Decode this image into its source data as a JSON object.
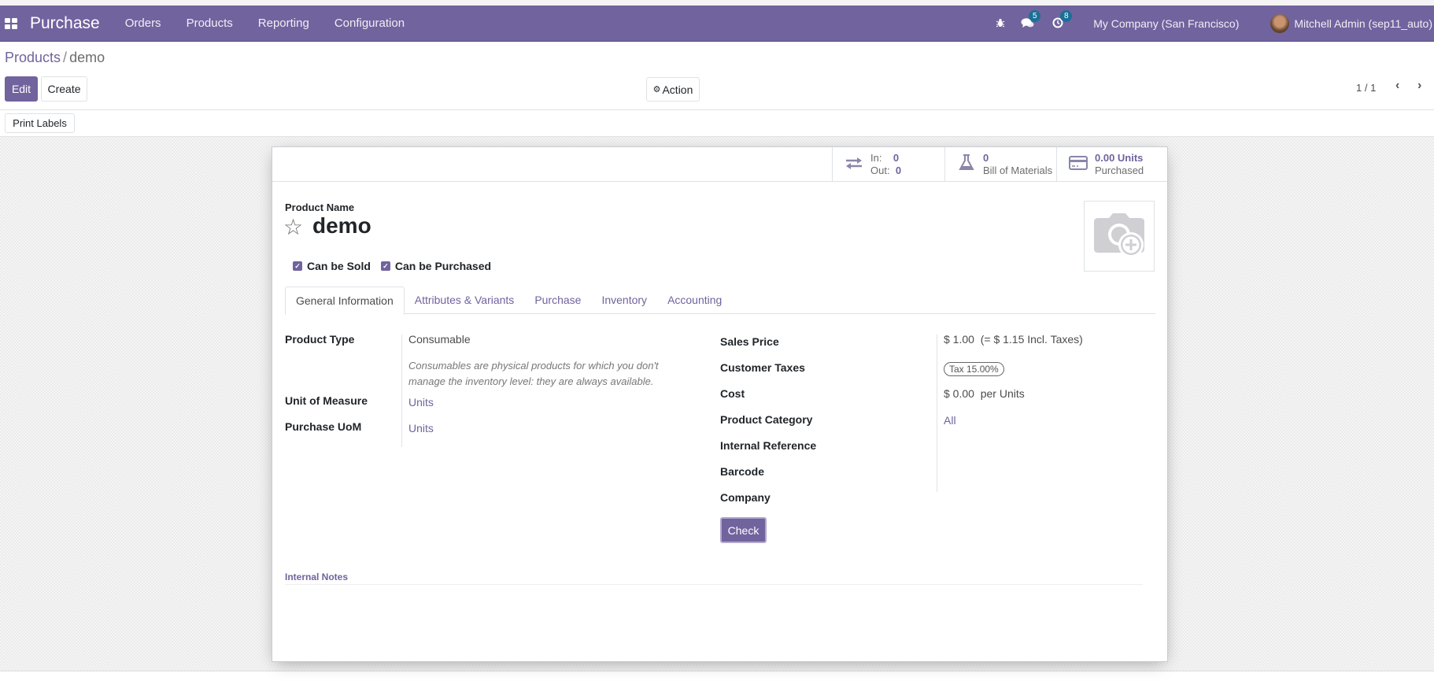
{
  "navbar": {
    "app_name": "Purchase",
    "menu": [
      "Orders",
      "Products",
      "Reporting",
      "Configuration"
    ],
    "messages_badge": "5",
    "activities_badge": "8",
    "company": "My Company (San Francisco)",
    "user": "Mitchell Admin (sep11_auto)"
  },
  "breadcrumb": {
    "parent": "Products",
    "separator": "/",
    "current": "demo"
  },
  "control_panel": {
    "edit_label": "Edit",
    "create_label": "Create",
    "action_label": "Action",
    "pager": "1 / 1"
  },
  "statusbar": {
    "print_labels": "Print Labels"
  },
  "stat_buttons": {
    "in_label": "In:",
    "in_value": "0",
    "out_label": "Out:",
    "out_value": "0",
    "bom_value": "0",
    "bom_label": "Bill of Materials",
    "purchased_value": "0.00 Units",
    "purchased_label": "Purchased"
  },
  "product": {
    "name_label": "Product Name",
    "name": "demo",
    "can_be_sold_label": "Can be Sold",
    "can_be_sold": true,
    "can_be_purchased_label": "Can be Purchased",
    "can_be_purchased": true
  },
  "tabs": [
    "General Information",
    "Attributes & Variants",
    "Purchase",
    "Inventory",
    "Accounting"
  ],
  "active_tab": "General Information",
  "general": {
    "left": {
      "product_type_label": "Product Type",
      "product_type": "Consumable",
      "product_type_help": "Consumables are physical products for which you don't manage the inventory level: they are always available.",
      "uom_label": "Unit of Measure",
      "uom": "Units",
      "purchase_uom_label": "Purchase UoM",
      "purchase_uom": "Units"
    },
    "right": {
      "sales_price_label": "Sales Price",
      "sales_price": "$ 1.00",
      "sales_price_incl": "(= $ 1.15 Incl. Taxes)",
      "customer_taxes_label": "Customer Taxes",
      "customer_taxes": "Tax 15.00%",
      "cost_label": "Cost",
      "cost": "$ 0.00",
      "cost_suffix": "per Units",
      "category_label": "Product Category",
      "category": "All",
      "internal_ref_label": "Internal Reference",
      "barcode_label": "Barcode",
      "company_label": "Company",
      "check_button": "Check"
    }
  },
  "internal_notes_label": "Internal Notes",
  "colors": {
    "brand": "#71639e",
    "badge": "#1b7096"
  }
}
